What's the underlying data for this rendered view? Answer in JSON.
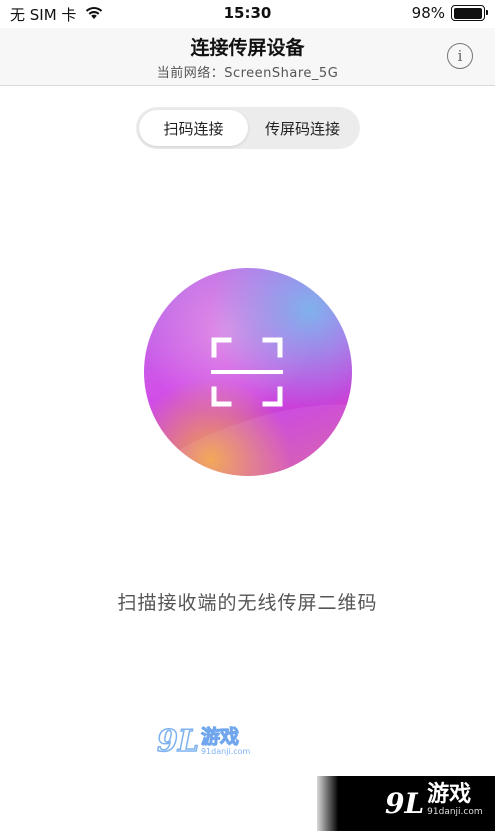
{
  "status_bar": {
    "carrier": "无 SIM 卡",
    "time": "15:30",
    "battery_text": "98%",
    "battery_level": 0.98,
    "wifi_icon": "wifi-icon"
  },
  "header": {
    "title": "连接传屏设备",
    "network_prefix": "当前网络：",
    "network_name": "ScreenShare_5G",
    "info_icon": "info-icon",
    "info_glyph": "i"
  },
  "tabs": [
    {
      "label": "扫码连接",
      "active": true
    },
    {
      "label": "传屏码连接",
      "active": false
    }
  ],
  "scan": {
    "icon": "qr-scan-icon",
    "caption": "扫描接收端的无线传屏二维码"
  },
  "watermark": {
    "number": "9L",
    "text": "游戏",
    "domain": "91danji.com"
  },
  "colors": {
    "nav_bg": "#f7f7f7",
    "segment_bg": "#ececec",
    "accent_purple": "#d150e8",
    "accent_orange": "#f1a24c",
    "accent_blue": "#7fb2ec"
  }
}
